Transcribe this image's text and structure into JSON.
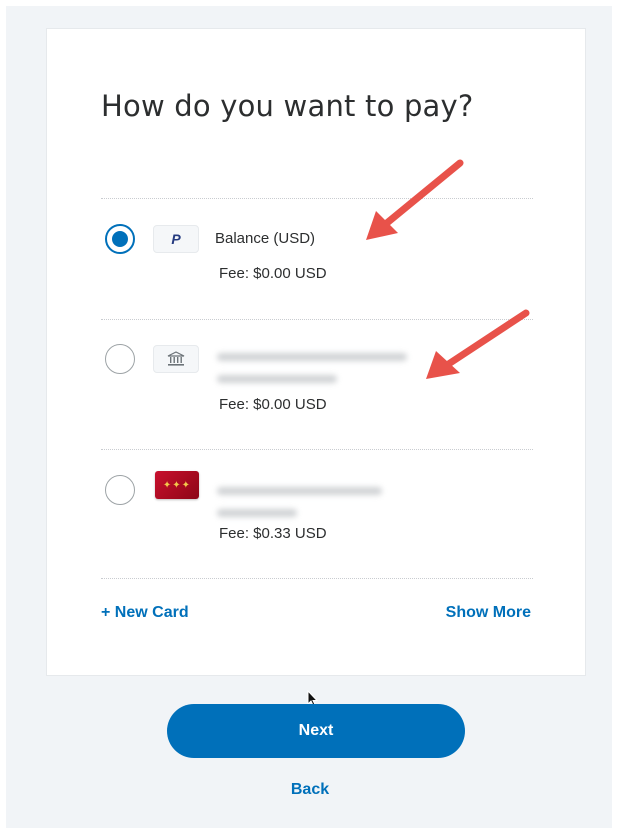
{
  "title": "How do you want to pay?",
  "options": [
    {
      "name": "Balance (USD)",
      "fee": "Fee: $0.00 USD",
      "selected": true,
      "icon": "paypal-icon"
    },
    {
      "name": "",
      "fee": "Fee: $0.00 USD",
      "selected": false,
      "icon": "bank-icon"
    },
    {
      "name": "",
      "fee": "Fee: $0.33 USD",
      "selected": false,
      "icon": "credit-card-icon"
    }
  ],
  "links": {
    "new_card": "+ New Card",
    "show_more": "Show More"
  },
  "buttons": {
    "next": "Next",
    "back": "Back"
  },
  "colors": {
    "accent": "#0070ba",
    "arrow": "#e8524a",
    "background": "#f1f4f7"
  }
}
